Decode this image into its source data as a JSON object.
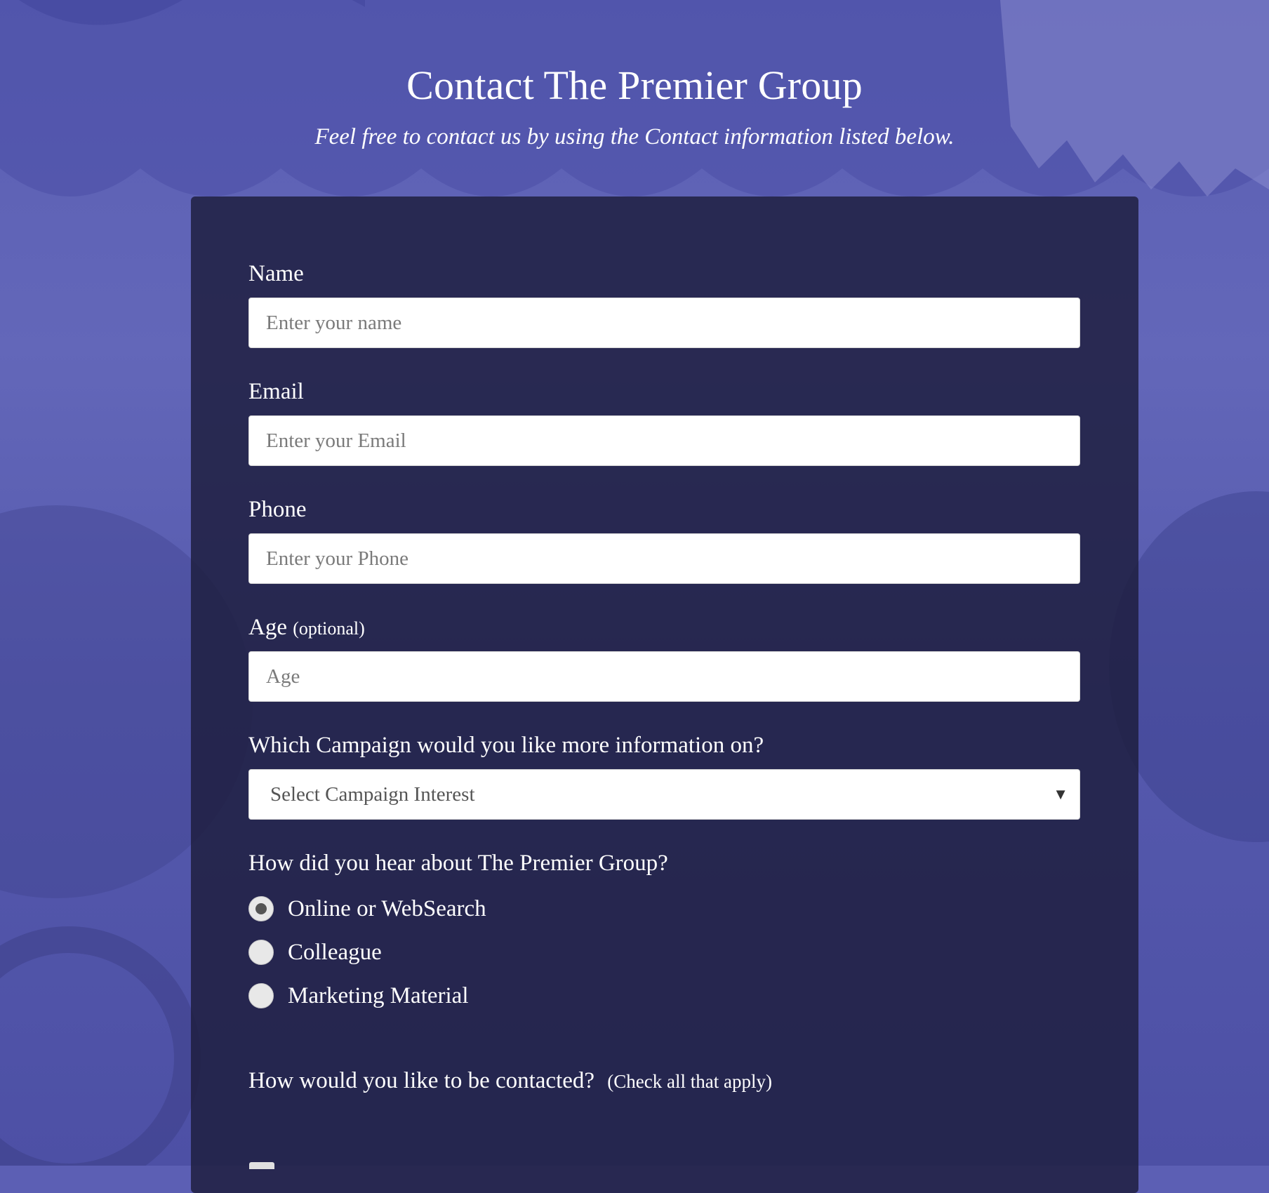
{
  "header": {
    "title": "Contact The Premier Group",
    "subtitle": "Feel free to contact us by using the Contact information listed below."
  },
  "form": {
    "name": {
      "label": "Name",
      "placeholder": "Enter your name"
    },
    "email": {
      "label": "Email",
      "placeholder": "Enter your Email"
    },
    "phone": {
      "label": "Phone",
      "placeholder": "Enter your Phone"
    },
    "age": {
      "label": "Age",
      "label_note": "(optional)",
      "placeholder": "Age"
    },
    "campaign": {
      "label": "Which Campaign would you like more information on?",
      "selected": "Select Campaign Interest",
      "caret": "▼"
    },
    "source": {
      "label": "How did you hear about The Premier Group?",
      "options": [
        {
          "label": "Online or WebSearch",
          "checked": true
        },
        {
          "label": "Colleague",
          "checked": false
        },
        {
          "label": "Marketing Material",
          "checked": false
        }
      ]
    },
    "contact_method": {
      "label": "How would you like to be contacted?",
      "note": "(Check all that apply)"
    }
  },
  "colors": {
    "background": "#5c5fb4",
    "card": "#1e1e3e",
    "text": "#ffffff",
    "input_bg": "#ffffff"
  }
}
